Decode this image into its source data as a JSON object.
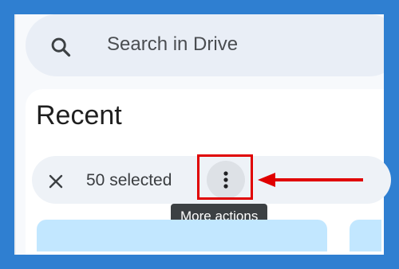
{
  "search": {
    "placeholder": "Search in Drive",
    "icon": "search-icon"
  },
  "page": {
    "title": "Recent"
  },
  "selection": {
    "count_label": "50 selected",
    "close_icon": "close-icon",
    "more_icon": "more-vertical-icon"
  },
  "tooltip": {
    "text": "More actions"
  },
  "colors": {
    "background": "#2f7fd1",
    "annotation": "#e00000",
    "tooltip_bg": "#3c4043",
    "card": "#c2e7ff"
  }
}
